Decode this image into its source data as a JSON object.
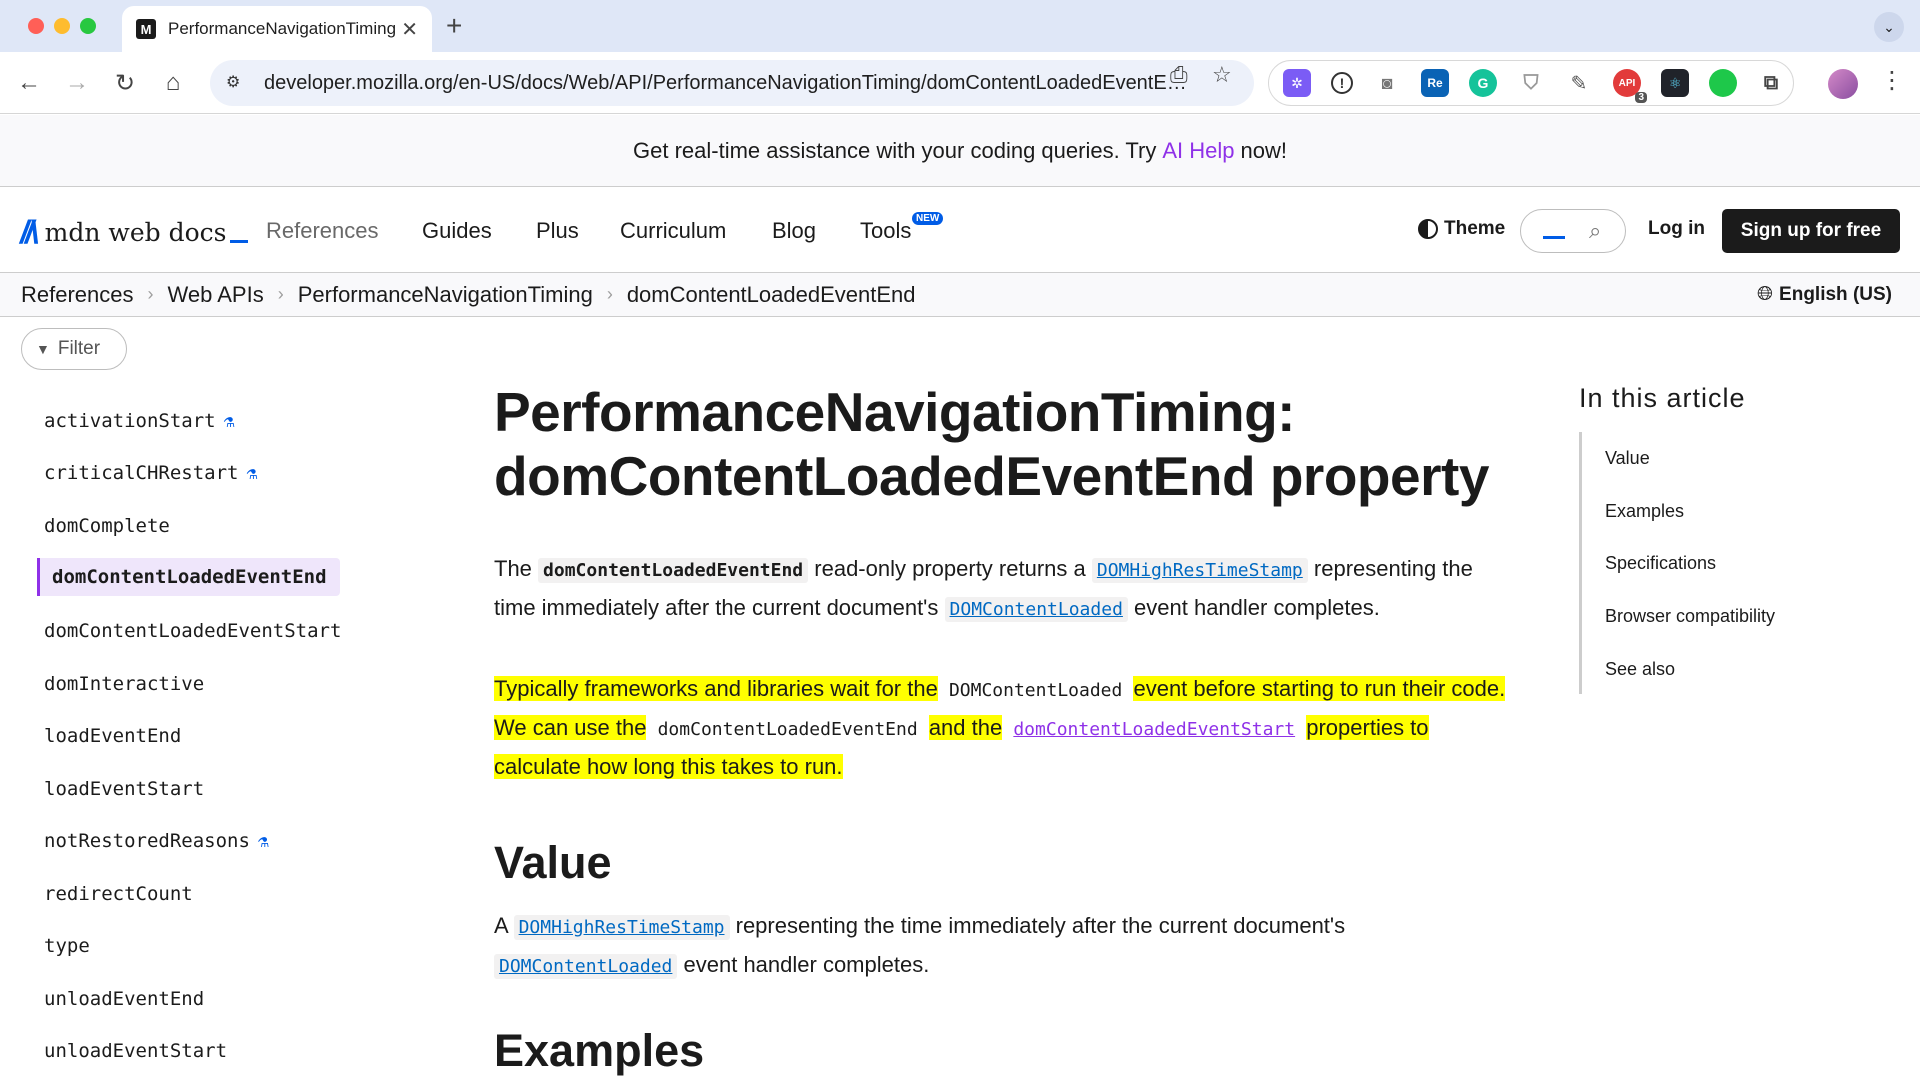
{
  "browser": {
    "tab_title": "PerformanceNavigationTiming",
    "tab_favicon": "M",
    "url": "developer.mozilla.org/en-US/docs/Web/API/PerformanceNavigationTiming/domContentLoadedEventE…",
    "extension_badge": "3"
  },
  "banner": {
    "text_before": "Get real-time assistance with your coding queries. Try",
    "link": "AI Help",
    "text_after": "now!"
  },
  "header": {
    "logo_text": "mdn web docs",
    "nav": [
      "References",
      "Guides",
      "Plus",
      "Curriculum",
      "Blog",
      "Tools"
    ],
    "new_badge": "NEW",
    "theme": "Theme",
    "login": "Log in",
    "signup": "Sign up for free"
  },
  "breadcrumb": {
    "items": [
      "References",
      "Web APIs",
      "PerformanceNavigationTiming",
      "domContentLoadedEventEnd"
    ],
    "language": "English (US)"
  },
  "sidebar": {
    "filter": "Filter",
    "items": [
      {
        "label": "activationStart",
        "experimental": true
      },
      {
        "label": "criticalCHRestart",
        "experimental": true
      },
      {
        "label": "domComplete",
        "experimental": false
      },
      {
        "label": "domContentLoadedEventEnd",
        "experimental": false,
        "active": true
      },
      {
        "label": "domContentLoadedEventStart",
        "experimental": false
      },
      {
        "label": "domInteractive",
        "experimental": false
      },
      {
        "label": "loadEventEnd",
        "experimental": false
      },
      {
        "label": "loadEventStart",
        "experimental": false
      },
      {
        "label": "notRestoredReasons",
        "experimental": true
      },
      {
        "label": "redirectCount",
        "experimental": false
      },
      {
        "label": "type",
        "experimental": false
      },
      {
        "label": "unloadEventEnd",
        "experimental": false
      },
      {
        "label": "unloadEventStart",
        "experimental": false
      }
    ]
  },
  "article": {
    "title_line1": "PerformanceNavigationTiming:",
    "title_line2": "domContentLoadedEventEnd property",
    "p1": {
      "t1": "The",
      "c1": "domContentLoadedEventEnd",
      "t2": "read-only property returns a",
      "l1": "DOMHighResTimeStamp",
      "t3": "representing the time immediately after the current document's",
      "l2": "DOMContentLoaded",
      "t4": "event handler completes."
    },
    "p2": {
      "t1": "Typically frameworks and libraries wait for the",
      "c1": "DOMContentLoaded",
      "t2": "event before starting to run their code. We can use the",
      "c2": "domContentLoadedEventEnd",
      "t3": "and the",
      "l1": "domContentLoadedEventStart",
      "t4": "properties to calculate how long this takes to run."
    },
    "value_heading": "Value",
    "value_p": {
      "t1": "A",
      "l1": "DOMHighResTimeStamp",
      "t2": "representing the time immediately after the current document's",
      "l2": "DOMContentLoaded",
      "t3": "event handler completes."
    },
    "examples_heading": "Examples"
  },
  "toc": {
    "title": "In this article",
    "items": [
      "Value",
      "Examples",
      "Specifications",
      "Browser compatibility",
      "See also"
    ]
  },
  "colors": {
    "accent": "#005ce6",
    "highlight": "#ffff00",
    "link": "#0069c2",
    "visited": "#8f31e8"
  }
}
